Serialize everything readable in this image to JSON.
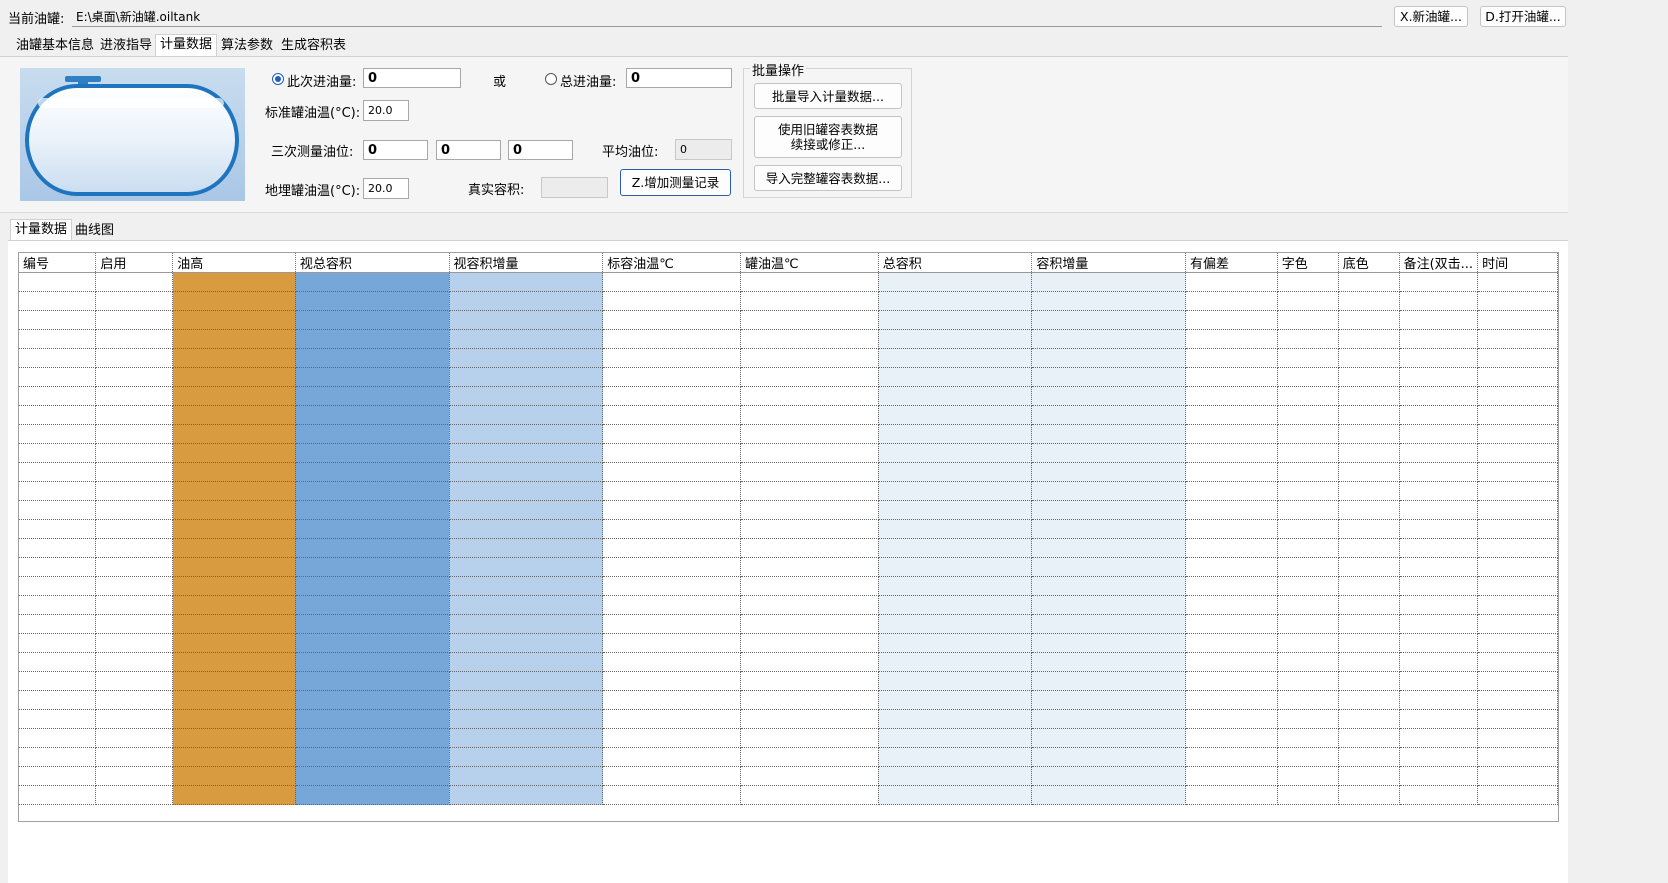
{
  "header": {
    "current_tank_label": "当前油罐:",
    "current_tank_path": "E:\\桌面\\新油罐.oiltank",
    "new_tank_button": "X.新油罐...",
    "open_tank_button": "D.打开油罐..."
  },
  "tabs": [
    {
      "label": "油罐基本信息",
      "active": false
    },
    {
      "label": "进液指导",
      "active": false
    },
    {
      "label": "计量数据",
      "active": true
    },
    {
      "label": "算法参数",
      "active": false
    },
    {
      "label": "生成容积表",
      "active": false
    }
  ],
  "form": {
    "this_intake_label": "此次进油量:",
    "this_intake_value": "0",
    "or_label": "或",
    "total_intake_label": "总进油量:",
    "total_intake_value": "0",
    "std_temp_label": "标准罐油温(°C):",
    "std_temp_value": "20.0",
    "three_level_label": "三次测量油位:",
    "level1": "0",
    "level2": "0",
    "level3": "0",
    "avg_level_label": "平均油位:",
    "avg_level_value": "0",
    "buried_temp_label": "地埋罐油温(°C):",
    "buried_temp_value": "20.0",
    "real_volume_label": "真实容积:",
    "real_volume_value": "",
    "add_record_button": "Z.增加测量记录"
  },
  "batch": {
    "title": "批量操作",
    "import_button": "批量导入计量数据...",
    "old_table_button_line1": "使用旧罐容表数据",
    "old_table_button_line2": "续接或修正...",
    "import_full_button": "导入完整罐容表数据..."
  },
  "subtabs": [
    {
      "label": "计量数据",
      "active": true
    },
    {
      "label": "曲线图",
      "active": false
    }
  ],
  "table": {
    "columns": [
      {
        "label": "编号",
        "bg": "#ffffff"
      },
      {
        "label": "启用",
        "bg": "#ffffff"
      },
      {
        "label": "油高",
        "bg": "#d89b40"
      },
      {
        "label": "视总容积",
        "bg": "#77a7d8"
      },
      {
        "label": "视容积增量",
        "bg": "#b7d0eb"
      },
      {
        "label": "标容油温℃",
        "bg": "#ffffff"
      },
      {
        "label": "罐油温℃",
        "bg": "#ffffff"
      },
      {
        "label": "总容积",
        "bg": "#e8f0f8"
      },
      {
        "label": "容积增量",
        "bg": "#e8f0f8"
      },
      {
        "label": "有偏差",
        "bg": "#ffffff"
      },
      {
        "label": "字色",
        "bg": "#ffffff"
      },
      {
        "label": "底色",
        "bg": "#ffffff"
      },
      {
        "label": "备注(双击...",
        "bg": "#ffffff"
      },
      {
        "label": "时间",
        "bg": "#ffffff"
      }
    ],
    "empty_rows": 28
  },
  "icons": {
    "tank_image": "horizontal-oil-tank"
  }
}
